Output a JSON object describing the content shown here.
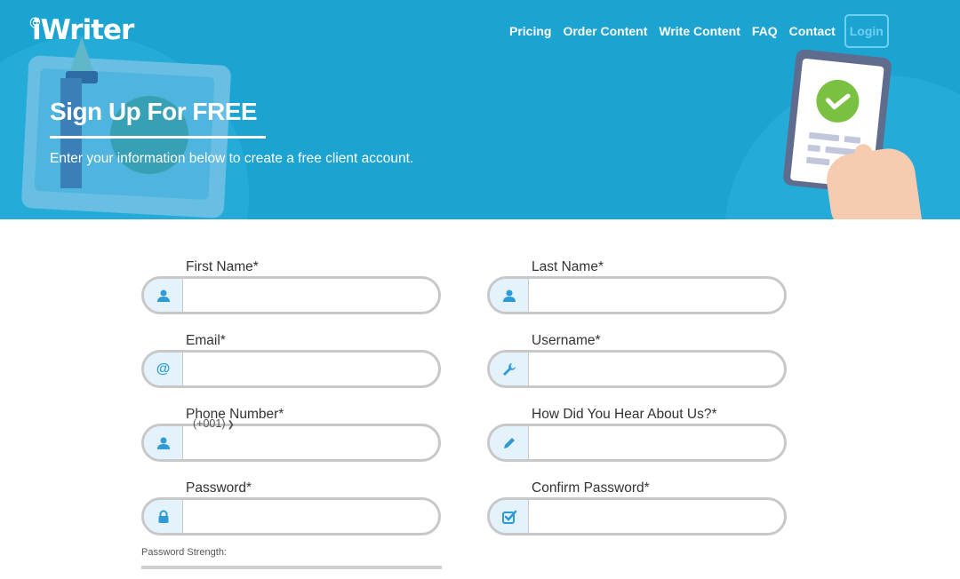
{
  "header": {
    "logo": {
      "at": "@",
      "text": "iWriter"
    },
    "nav": {
      "items": [
        "Pricing",
        "Order Content",
        "Write Content",
        "FAQ",
        "Contact"
      ],
      "login": "Login"
    },
    "title": "Sign Up For FREE",
    "subtitle": "Enter your information below to create a free client account."
  },
  "form": {
    "first_name": {
      "label": "First Name*",
      "value": "",
      "icon": "user-icon"
    },
    "last_name": {
      "label": "Last Name*",
      "value": "",
      "icon": "user-icon"
    },
    "email": {
      "label": "Email*",
      "value": "",
      "icon": "at-icon"
    },
    "username": {
      "label": "Username*",
      "value": "",
      "icon": "wrench-icon"
    },
    "phone": {
      "label": "Phone Number*",
      "value": "",
      "country_code": "(+001)",
      "icon": "user-icon"
    },
    "hear_about": {
      "label": "How Did You Hear About Us?*",
      "value": "",
      "icon": "pen-icon"
    },
    "password": {
      "label": "Password*",
      "value": "",
      "icon": "lock-icon"
    },
    "confirm_password": {
      "label": "Confirm Password*",
      "value": "",
      "icon": "check-square-icon"
    },
    "password_strength_label": "Password Strength:"
  },
  "colors": {
    "hero_bg": "#1ba3d2",
    "icon_blue": "#2f9bd6",
    "field_border": "#c8c8c8",
    "icon_cell_bg": "#e3f2fb",
    "check_green": "#7ac142"
  }
}
